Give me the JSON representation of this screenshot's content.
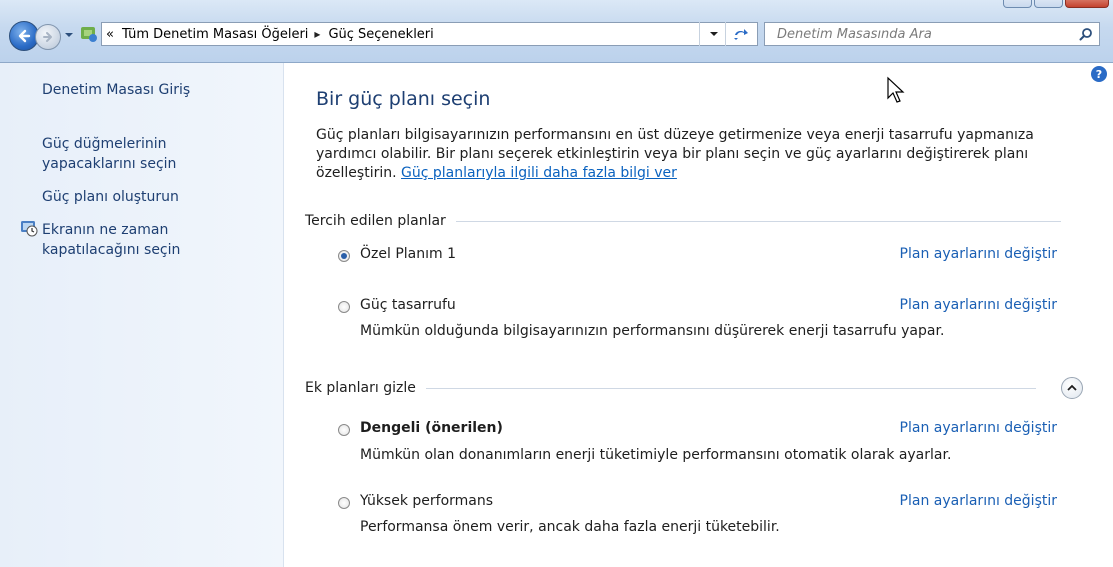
{
  "toolbar": {
    "breadcrumb_sep": "«",
    "breadcrumb": [
      "Tüm Denetim Masası Öğeleri",
      "Güç Seçenekleri"
    ],
    "breadcrumb_arrow": "▸",
    "search_placeholder": "Denetim Masasında Ara"
  },
  "sidebar": {
    "items": [
      {
        "label": "Denetim Masası Giriş"
      },
      {
        "label": "Güç düğmelerinin yapacaklarını seçin"
      },
      {
        "label": "Güç planı oluşturun"
      },
      {
        "label": "Ekranın ne zaman kapatılacağını seçin"
      }
    ]
  },
  "main": {
    "title": "Bir güç planı seçin",
    "description": "Güç planları bilgisayarınızın performansını en üst düzeye getirmenize veya enerji tasarrufu yapmanıza yardımcı olabilir. Bir planı seçerek etkinleştirin veya bir planı seçin ve güç ayarlarını değiştirerek planı özelleştirin.",
    "more_info_link": "Güç planlarıyla ilgili daha fazla bilgi ver",
    "preferred_section": "Tercih edilen planlar",
    "hidden_section": "Ek planları gizle",
    "change_link": "Plan ayarlarını değiştir",
    "plans": [
      {
        "name": "Özel Planım 1",
        "selected": true,
        "description": ""
      },
      {
        "name": "Güç tasarrufu",
        "selected": false,
        "description": "Mümkün olduğunda bilgisayarınızın performansını düşürerek enerji tasarrufu yapar."
      },
      {
        "name": "Dengeli (önerilen)",
        "selected": false,
        "description": "Mümkün olan donanımların enerji tüketimiyle performansını otomatik olarak ayarlar."
      },
      {
        "name": "Yüksek performans",
        "selected": false,
        "description": "Performansa önem verir, ancak daha fazla enerji tüketebilir."
      }
    ]
  },
  "colors": {
    "link": "#1a5fb4",
    "title": "#1e3f72",
    "chrome": "#c6d9ef"
  }
}
